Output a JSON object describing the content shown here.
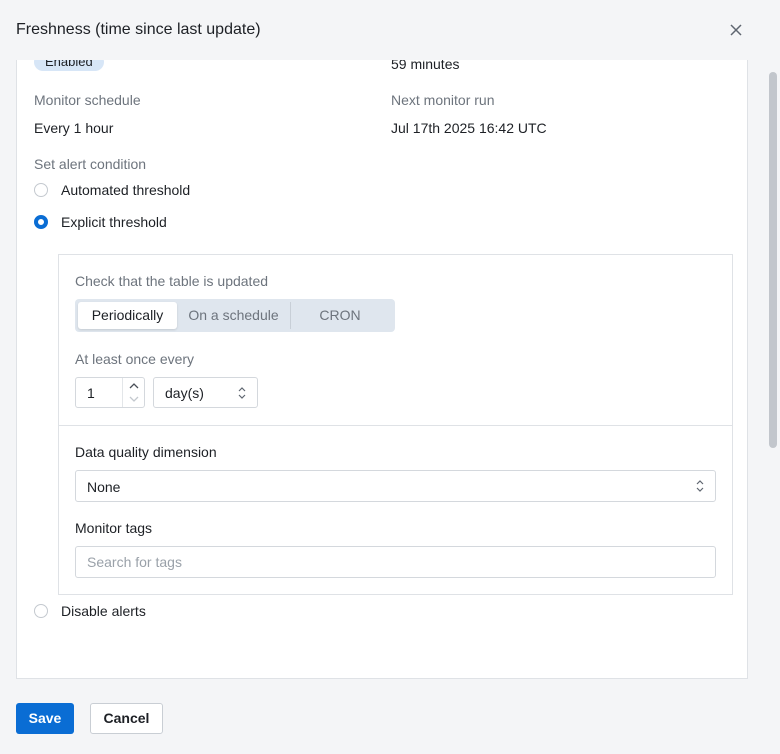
{
  "dialog": {
    "title": "Freshness (time since last update)"
  },
  "status": {
    "badge": "Enabled",
    "last_value": "59 minutes"
  },
  "schedule": {
    "label": "Monitor schedule",
    "value": "Every 1 hour",
    "next_label": "Next monitor run",
    "next_value": "Jul 17th 2025 16:42 UTC"
  },
  "alert": {
    "label": "Set alert condition",
    "options": [
      {
        "label": "Automated threshold",
        "checked": false
      },
      {
        "label": "Explicit threshold",
        "checked": true
      },
      {
        "label": "Disable alerts",
        "checked": false
      }
    ]
  },
  "explicit": {
    "check_label": "Check that the table is updated",
    "tabs": [
      "Periodically",
      "On a schedule",
      "CRON"
    ],
    "active_tab": "Periodically",
    "interval_label": "At least once every",
    "interval_value": "1",
    "interval_unit": "day(s)"
  },
  "dimension": {
    "label": "Data quality dimension",
    "value": "None"
  },
  "tags": {
    "label": "Monitor tags",
    "placeholder": "Search for tags"
  },
  "footer": {
    "save_label": "Save",
    "cancel_label": "Cancel"
  },
  "colors": {
    "primary": "#0a6dd4",
    "badge_bg": "#d7e6f7"
  }
}
